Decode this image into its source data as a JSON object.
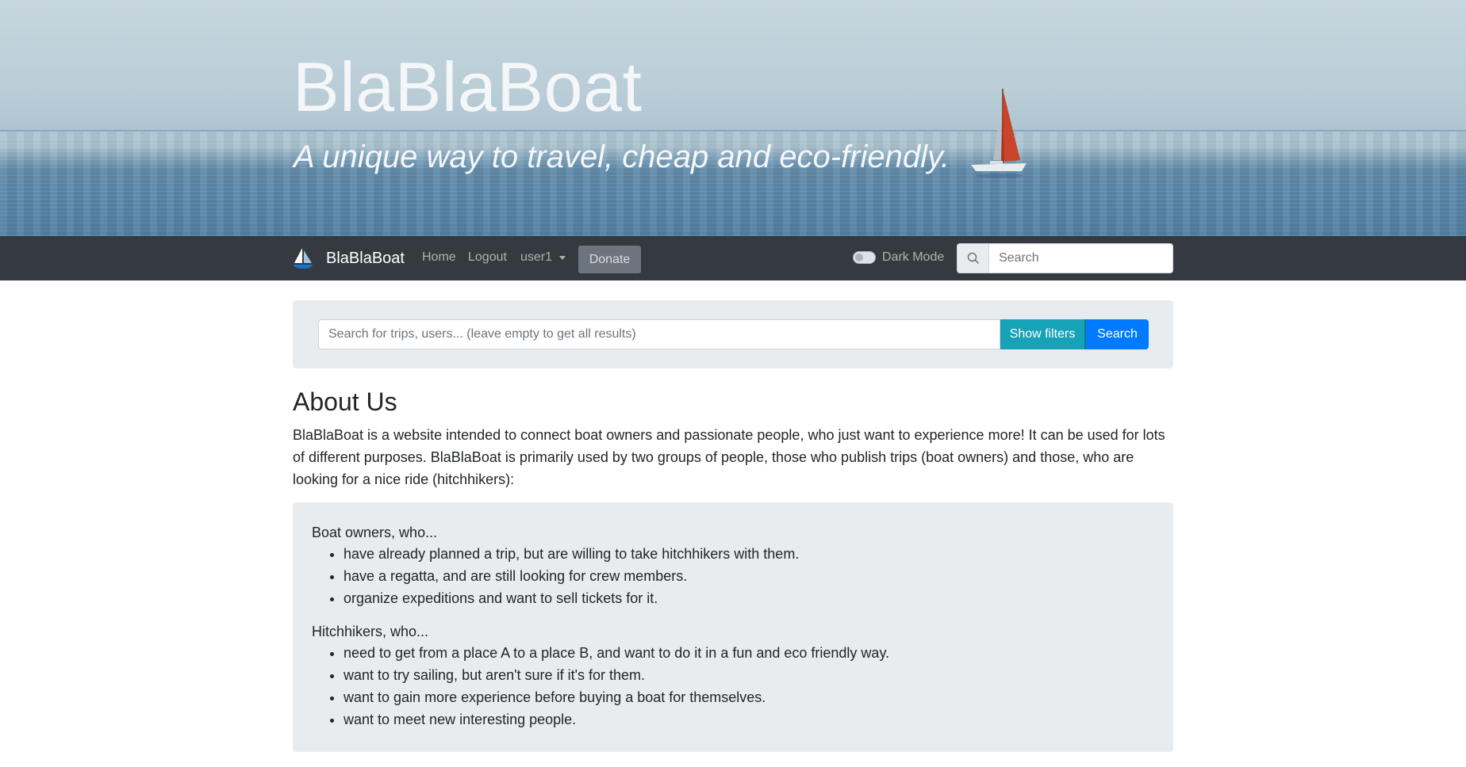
{
  "hero": {
    "title": "BlaBlaBoat",
    "subtitle": "A unique way to travel, cheap and eco-friendly."
  },
  "navbar": {
    "brand": "BlaBlaBoat",
    "brand_icon": "sailboat-logo-icon",
    "links": {
      "home": "Home",
      "logout": "Logout",
      "user": "user1"
    },
    "donate_label": "Donate",
    "dark_mode_label": "Dark Mode",
    "dark_mode_on": false,
    "search_placeholder": "Search",
    "search_icon": "search-icon",
    "background_color": "#343a40"
  },
  "search_panel": {
    "placeholder": "Search for trips, users... (leave empty to get all results)",
    "show_filters_label": "Show filters",
    "search_label": "Search",
    "show_filters_color": "#17a2b8",
    "search_color": "#007bff"
  },
  "about": {
    "title": "About Us",
    "text": "BlaBlaBoat is a website intended to connect boat owners and passionate people, who just want to experience more! It can be used for lots of different purposes. BlaBlaBoat is primarily used by two groups of people, those who publish trips (boat owners) and those, who are looking for a nice ride (hitchhikers):",
    "groups": [
      {
        "title": "Boat owners, who...",
        "items": [
          "have already planned a trip, but are willing to take hitchhikers with them.",
          "have a regatta, and are still looking for crew members.",
          "organize expeditions and want to sell tickets for it."
        ]
      },
      {
        "title": "Hitchhikers, who...",
        "items": [
          "need to get from a place A to a place B, and want to do it in a fun and eco friendly way.",
          "want to try sailing, but aren't sure if it's for them.",
          "want to gain more experience before buying a boat for themselves.",
          "want to meet new interesting people."
        ]
      }
    ]
  }
}
